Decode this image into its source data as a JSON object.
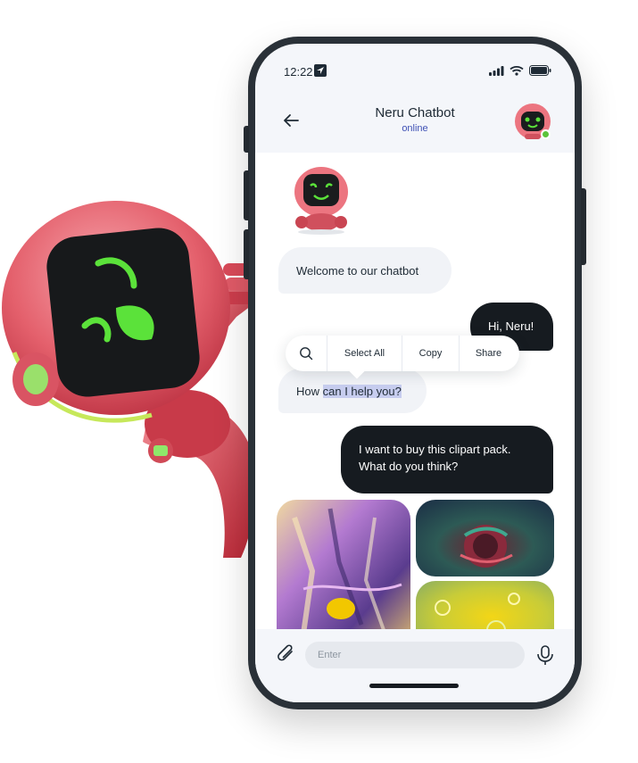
{
  "status_bar": {
    "time": "12:22"
  },
  "header": {
    "title": "Neru Chatbot",
    "status": "online"
  },
  "messages": [
    {
      "from": "bot",
      "text": "Welcome to our chatbot"
    },
    {
      "from": "user",
      "text": "Hi, Neru!"
    },
    {
      "from": "bot",
      "text_before": "How ",
      "text_selected": "can I help you?"
    },
    {
      "from": "user",
      "text": "I want to buy this clipart pack. What do you think?"
    }
  ],
  "context_menu": {
    "select_all": "Select All",
    "copy": "Copy",
    "share": "Share"
  },
  "input": {
    "placeholder": "Enter"
  },
  "colors": {
    "accent": "#3f51b5",
    "online": "#5ac43b",
    "dark_bubble": "#161b20",
    "robot": "#e8606c"
  }
}
